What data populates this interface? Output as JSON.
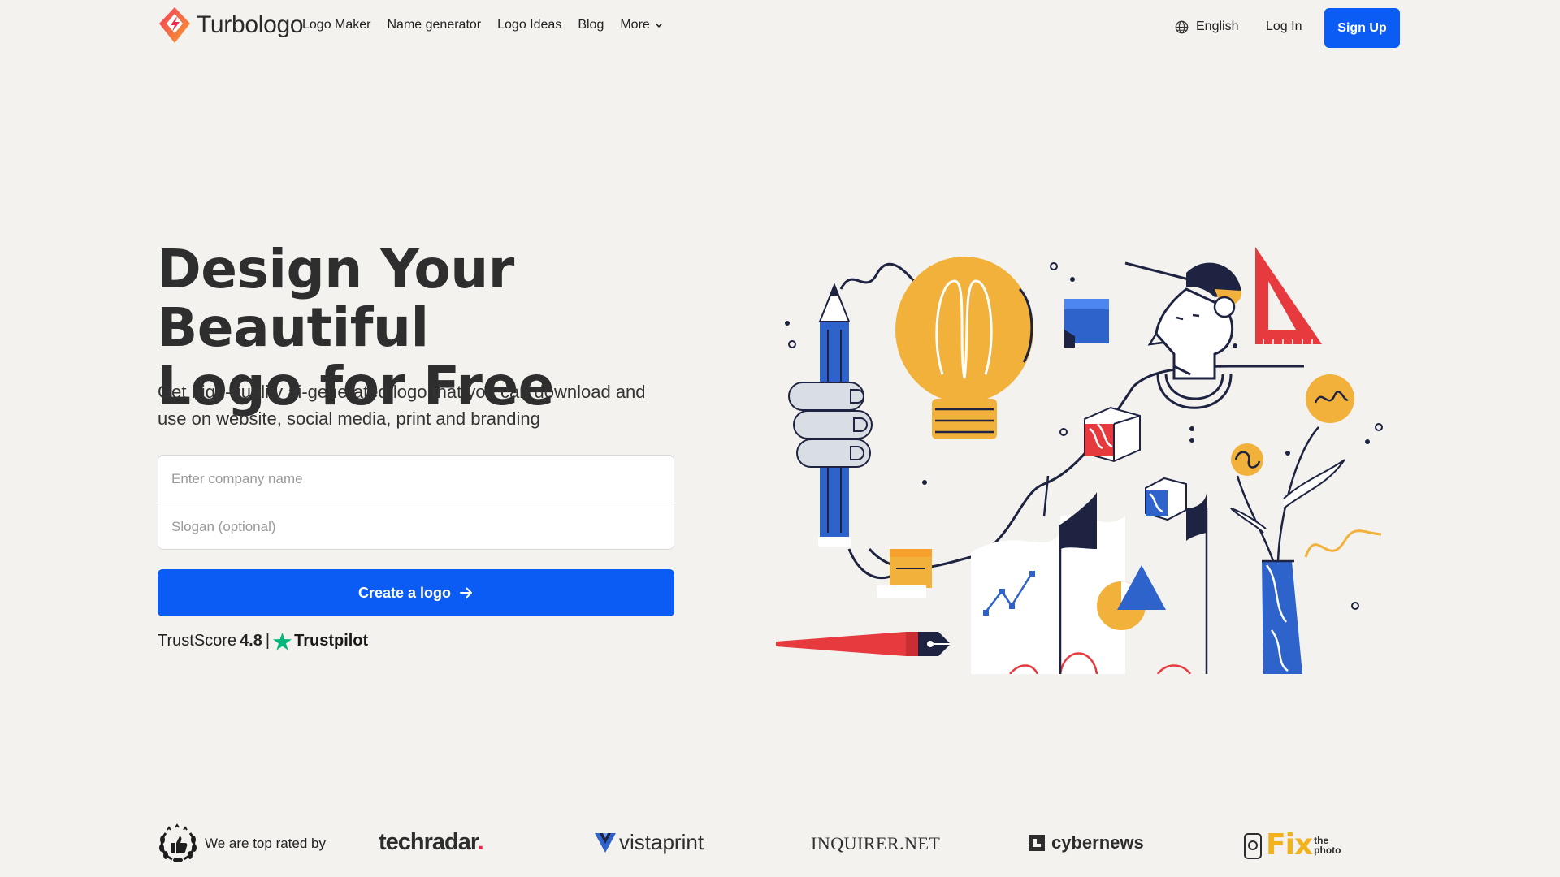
{
  "brand": {
    "name": "Turbologo"
  },
  "nav": {
    "items": [
      "Logo Maker",
      "Name generator",
      "Logo Ideas",
      "Blog"
    ],
    "more_label": "More"
  },
  "header": {
    "language": "English",
    "login": "Log In",
    "signup": "Sign Up"
  },
  "hero": {
    "title_line1": "Design Your Beautiful",
    "title_line2": "Logo for Free",
    "subtitle": "Get high-quality ai-generated logo that you can download and use on website, social media, print and branding",
    "company_placeholder": "Enter company name",
    "slogan_placeholder": "Slogan (optional)",
    "cta_label": "Create a logo"
  },
  "trust": {
    "prefix": "TrustScore",
    "score": "4.8",
    "separator": "|",
    "brand": "Trustpilot"
  },
  "rated_by": {
    "label": "We are top rated by",
    "techradar": "techradar",
    "techradar_dot": ".",
    "vistaprint": "vistaprint",
    "inquirer": "INQUIRER.NET",
    "cybernews": "cybernews",
    "fix": "Fix",
    "fix_the": "the",
    "fix_photo": "photo"
  },
  "colors": {
    "accent": "#0a5cf5",
    "background": "#f4f2ee",
    "trustpilot_green": "#00b67a",
    "illus_yellow": "#f2b13a",
    "illus_blue": "#2f63cc",
    "illus_red": "#e63a3f",
    "illus_navy": "#1d2340"
  },
  "icons": {
    "logo": "turbologo-diamond-icon",
    "more": "chevron-down-icon",
    "language": "globe-icon",
    "cta": "arrow-right-icon",
    "trust": "star-icon",
    "rated": "laurel-thumbs-up-icon"
  }
}
